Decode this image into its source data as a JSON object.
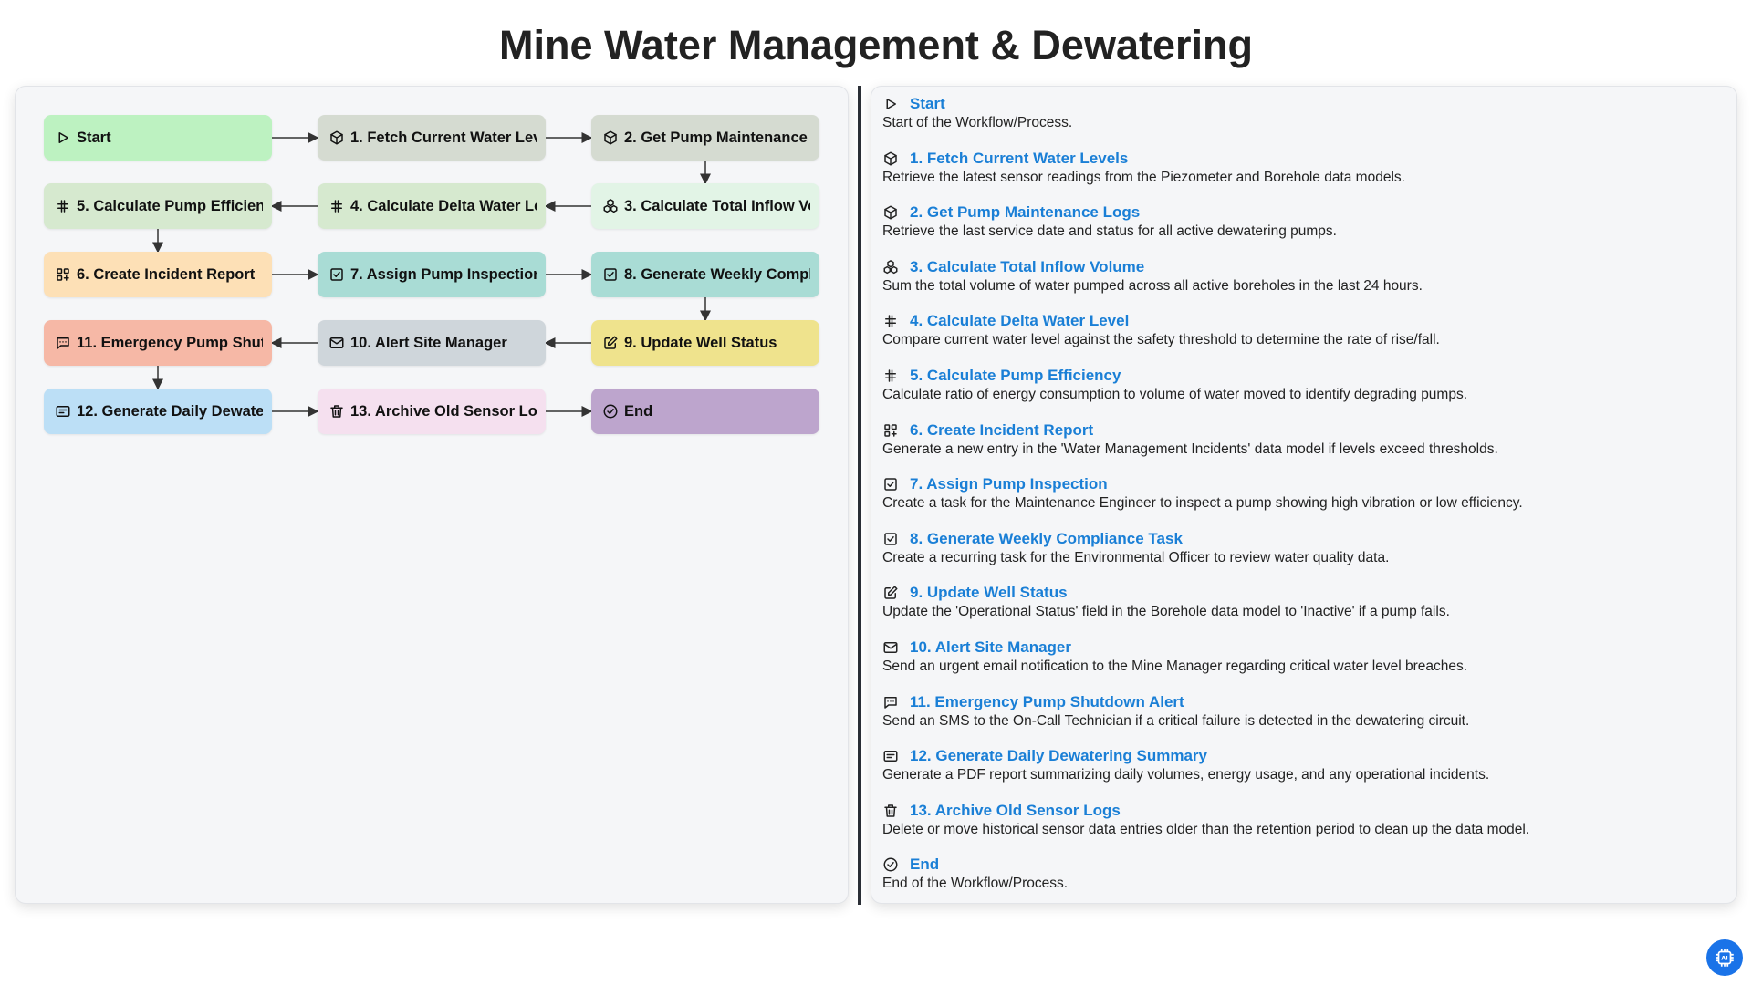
{
  "title": "Mine Water Management & Dewatering",
  "colors": {
    "start": "#bdf2c1",
    "fetch": "#d5dbd1",
    "model": "#d6e9cf",
    "calc_inflow": "#e2f4e6",
    "incident": "#fde0b6",
    "task": "#a9dcd5",
    "update": "#efe38d",
    "alert": "#cfd6db",
    "emergency": "#f6b8a6",
    "report": "#bcdff6",
    "archive": "#f5e0ef",
    "end": "#bda5cd",
    "link": "#1a7fd6"
  },
  "nodes": [
    {
      "id": "start",
      "label": "Start",
      "icon": "play-icon",
      "color": "start"
    },
    {
      "id": "n1",
      "label": "1. Fetch Current Water Levels",
      "icon": "cube-icon",
      "color": "fetch"
    },
    {
      "id": "n2",
      "label": "2. Get Pump Maintenance Logs",
      "icon": "cube-icon",
      "color": "fetch"
    },
    {
      "id": "n3",
      "label": "3. Calculate Total Inflow Volume",
      "icon": "cubes-icon",
      "color": "calc_inflow"
    },
    {
      "id": "n4",
      "label": "4. Calculate Delta Water Level",
      "icon": "hash-icon",
      "color": "model"
    },
    {
      "id": "n5",
      "label": "5. Calculate Pump Efficiency",
      "icon": "hash-icon",
      "color": "model"
    },
    {
      "id": "n6",
      "label": "6. Create Incident Report",
      "icon": "grid-plus-icon",
      "color": "incident"
    },
    {
      "id": "n7",
      "label": "7. Assign Pump Inspection",
      "icon": "checkbox-icon",
      "color": "task"
    },
    {
      "id": "n8",
      "label": "8. Generate Weekly Compliance Task",
      "icon": "checkbox-icon",
      "color": "task"
    },
    {
      "id": "n9",
      "label": "9. Update Well Status",
      "icon": "edit-icon",
      "color": "update"
    },
    {
      "id": "n10",
      "label": "10. Alert Site Manager",
      "icon": "mail-icon",
      "color": "alert"
    },
    {
      "id": "n11",
      "label": "11. Emergency Pump Shutdown Alert",
      "icon": "sms-icon",
      "color": "emergency"
    },
    {
      "id": "n12",
      "label": "12. Generate Daily Dewatering Summary",
      "icon": "report-icon",
      "color": "report"
    },
    {
      "id": "n13",
      "label": "13. Archive Old Sensor Logs",
      "icon": "trash-icon",
      "color": "archive"
    },
    {
      "id": "end",
      "label": "End",
      "icon": "check-circle-icon",
      "color": "end"
    }
  ],
  "steps": [
    {
      "title": "Start",
      "icon": "play-icon",
      "desc": "Start of the Workflow/Process."
    },
    {
      "title": "1. Fetch Current Water Levels",
      "icon": "cube-icon",
      "desc": "Retrieve the latest sensor readings from the Piezometer and Borehole data models."
    },
    {
      "title": "2. Get Pump Maintenance Logs",
      "icon": "cube-icon",
      "desc": "Retrieve the last service date and status for all active dewatering pumps."
    },
    {
      "title": "3. Calculate Total Inflow Volume",
      "icon": "cubes-icon",
      "desc": "Sum the total volume of water pumped across all active boreholes in the last 24 hours."
    },
    {
      "title": "4. Calculate Delta Water Level",
      "icon": "hash-icon",
      "desc": "Compare current water level against the safety threshold to determine the rate of rise/fall."
    },
    {
      "title": "5. Calculate Pump Efficiency",
      "icon": "hash-icon",
      "desc": "Calculate ratio of energy consumption to volume of water moved to identify degrading pumps."
    },
    {
      "title": "6. Create Incident Report",
      "icon": "grid-plus-icon",
      "desc": "Generate a new entry in the 'Water Management Incidents' data model if levels exceed thresholds."
    },
    {
      "title": "7. Assign Pump Inspection",
      "icon": "checkbox-icon",
      "desc": "Create a task for the Maintenance Engineer to inspect a pump showing high vibration or low efficiency."
    },
    {
      "title": "8. Generate Weekly Compliance Task",
      "icon": "checkbox-icon",
      "desc": "Create a recurring task for the Environmental Officer to review water quality data."
    },
    {
      "title": "9. Update Well Status",
      "icon": "edit-icon",
      "desc": "Update the 'Operational Status' field in the Borehole data model to 'Inactive' if a pump fails."
    },
    {
      "title": "10. Alert Site Manager",
      "icon": "mail-icon",
      "desc": "Send an urgent email notification to the Mine Manager regarding critical water level breaches."
    },
    {
      "title": "11. Emergency Pump Shutdown Alert",
      "icon": "sms-icon",
      "desc": "Send an SMS to the On-Call Technician if a critical failure is detected in the dewatering circuit."
    },
    {
      "title": "12. Generate Daily Dewatering Summary",
      "icon": "report-icon",
      "desc": "Generate a PDF report summarizing daily volumes, energy usage, and any operational incidents."
    },
    {
      "title": "13. Archive Old Sensor Logs",
      "icon": "trash-icon",
      "desc": "Delete or move historical sensor data entries older than the retention period to clean up the data model."
    },
    {
      "title": "End",
      "icon": "check-circle-icon",
      "desc": "End of the Workflow/Process."
    }
  ],
  "badge": {
    "icon": "ai-chip-icon"
  }
}
